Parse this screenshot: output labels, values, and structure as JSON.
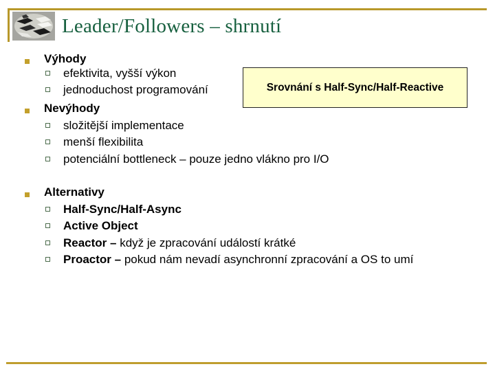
{
  "slide": {
    "title": "Leader/Followers – shrnutí",
    "logo_icon": "leader-followers-logo-icon",
    "colors": {
      "title": "#17603f",
      "frame": "#b8982a",
      "bullet_main": "#c3a02c",
      "bullet_sub_border": "#4b6b4b",
      "callout_bg": "#ffffcc"
    }
  },
  "sections": [
    {
      "heading": "Výhody",
      "items": [
        {
          "text": "efektivita, vyšší výkon"
        },
        {
          "text": "jednoduchost programování"
        }
      ]
    },
    {
      "heading": "Nevýhody",
      "items": [
        {
          "text": "složitější implementace"
        },
        {
          "text": "menší flexibilita"
        },
        {
          "text": "potenciální bottleneck – pouze jedno vlákno pro I/O"
        }
      ]
    },
    {
      "heading": "Alternativy",
      "items": [
        {
          "bold": "Half-Sync/Half-Async",
          "rest": ""
        },
        {
          "bold": "Active Object",
          "rest": ""
        },
        {
          "bold": "Reactor –",
          "rest": " když je zpracování událostí krátké"
        },
        {
          "bold": "Proactor –",
          "rest": " pokud nám nevadí asynchronní zpracování a OS to umí"
        }
      ]
    }
  ],
  "callout": {
    "text": "Srovnání s Half-Sync/Half-Reactive"
  }
}
